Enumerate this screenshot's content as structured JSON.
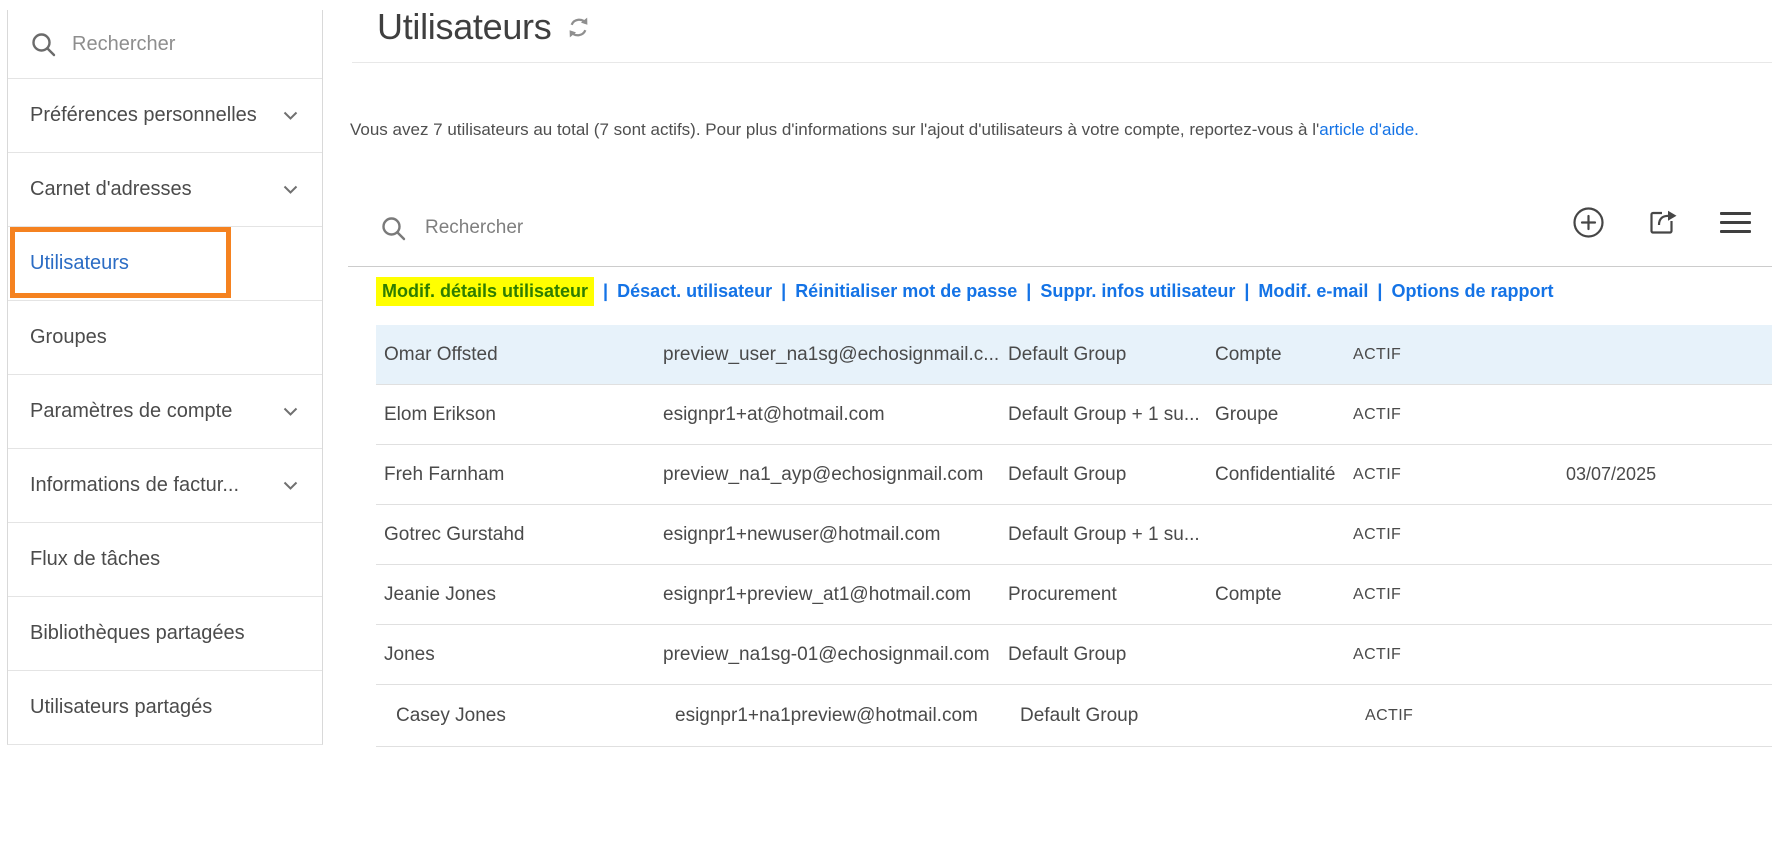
{
  "sidebar": {
    "search": {
      "placeholder": "Rechercher"
    },
    "items": [
      {
        "label": "Préférences personnelles",
        "chevron": true
      },
      {
        "label": "Carnet d'adresses",
        "chevron": true
      },
      {
        "label": "Utilisateurs",
        "chevron": false,
        "active": true
      },
      {
        "label": "Groupes",
        "chevron": false
      },
      {
        "label": "Paramètres de compte",
        "chevron": true
      },
      {
        "label": "Informations de factur...",
        "chevron": true
      },
      {
        "label": "Flux de tâches",
        "chevron": false
      },
      {
        "label": "Bibliothèques partagées",
        "chevron": false
      },
      {
        "label": "Utilisateurs partagés",
        "chevron": false
      }
    ]
  },
  "header": {
    "title": "Utilisateurs"
  },
  "info": {
    "text": "Vous avez 7 utilisateurs au total (7 sont actifs). Pour plus d'informations sur l'ajout d'utilisateurs à votre compte, reportez-vous à l'",
    "link_label": "article d'aide."
  },
  "toolbar": {
    "search_placeholder": "Rechercher"
  },
  "actions": {
    "separator": "|",
    "highlighted_link": "Modif. détails utilisateur",
    "links": [
      "Désact. utilisateur",
      "Réinitialiser mot de passe",
      "Suppr. infos utilisateur",
      "Modif. e-mail",
      "Options de rapport"
    ]
  },
  "table": {
    "rows": [
      {
        "name": "Omar Offsted",
        "email": "preview_user_na1sg@echosignmail.c...",
        "group": "Default Group",
        "admin_level": "Compte",
        "status": "ACTIF",
        "date": ""
      },
      {
        "name": "Elom Erikson",
        "email": "esignpr1+at@hotmail.com",
        "group": "Default Group + 1 su...",
        "admin_level": "Groupe",
        "status": "ACTIF",
        "date": ""
      },
      {
        "name": "Freh Farnham",
        "email": "preview_na1_ayp@echosignmail.com",
        "group": "Default Group",
        "admin_level": "Confidentialité",
        "status": "ACTIF",
        "date": "03/07/2025"
      },
      {
        "name": "Gotrec Gurstahd",
        "email": "esignpr1+newuser@hotmail.com",
        "group": "Default Group + 1 su...",
        "admin_level": "",
        "status": "ACTIF",
        "date": ""
      },
      {
        "name": "Jeanie Jones",
        "email": "esignpr1+preview_at1@hotmail.com",
        "group": "Procurement",
        "admin_level": "Compte",
        "status": "ACTIF",
        "date": ""
      },
      {
        "name": "Jones",
        "email": "preview_na1sg-01@echosignmail.com",
        "group": "Default Group",
        "admin_level": "",
        "status": "ACTIF",
        "date": ""
      },
      {
        "name": "Casey Jones",
        "email": "esignpr1+na1preview@hotmail.com",
        "group": "Default Group",
        "admin_level": "",
        "status": "ACTIF",
        "date": ""
      }
    ]
  },
  "icons": {
    "sidebar_search": "search-icon",
    "item_expander": "chevron-down-icon",
    "title_refresh": "refresh-icon",
    "toolbar_search": "search-icon",
    "add_user": "plus-circle-icon",
    "export": "export-icon",
    "menu": "hamburger-menu-icon"
  },
  "colors": {
    "link_blue": "#1473e6",
    "active_nav_blue": "#2b6cc4",
    "highlight_yellow": "#ffff00",
    "highlight_text_green": "#2e7d00",
    "selected_row_blue": "#e7f2fa",
    "annotation_orange": "#f58220",
    "text_gray": "#4a4a4a"
  }
}
